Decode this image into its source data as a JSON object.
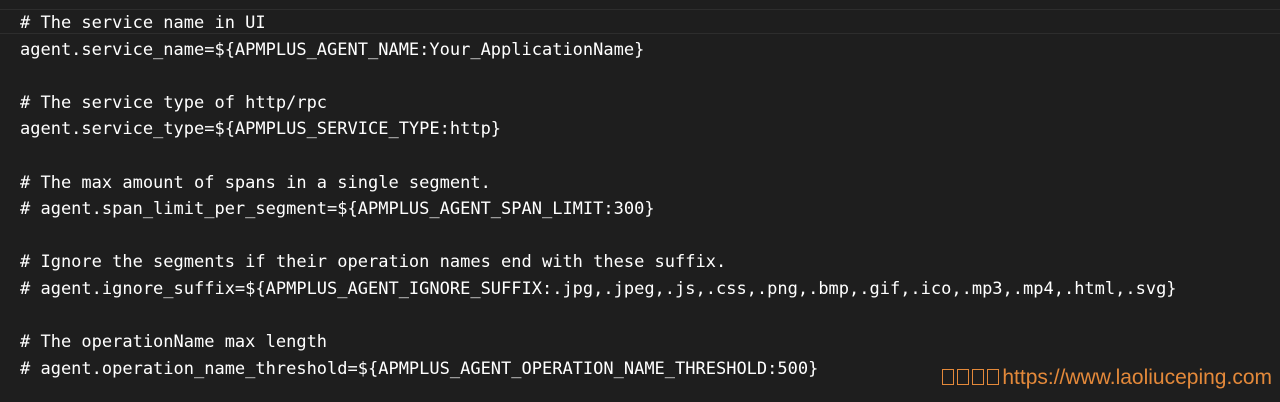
{
  "editor": {
    "lines": [
      "# The service name in UI",
      "agent.service_name=${APMPLUS_AGENT_NAME:Your_ApplicationName}",
      "",
      "# The service type of http/rpc",
      "agent.service_type=${APMPLUS_SERVICE_TYPE:http}",
      "",
      "# The max amount of spans in a single segment.",
      "# agent.span_limit_per_segment=${APMPLUS_AGENT_SPAN_LIMIT:300}",
      "",
      "# Ignore the segments if their operation names end with these suffix.",
      "# agent.ignore_suffix=${APMPLUS_AGENT_IGNORE_SUFFIX:.jpg,.jpeg,.js,.css,.png,.bmp,.gif,.ico,.mp3,.mp4,.html,.svg}",
      "",
      "# The operationName max length",
      "# agent.operation_name_threshold=${APMPLUS_AGENT_OPERATION_NAME_THRESHOLD:500}"
    ]
  },
  "watermark": {
    "url": "https://www.laoliuceping.com",
    "color": "#e4893a"
  },
  "colors": {
    "background": "#1e1e1e",
    "text": "#ffffff"
  }
}
